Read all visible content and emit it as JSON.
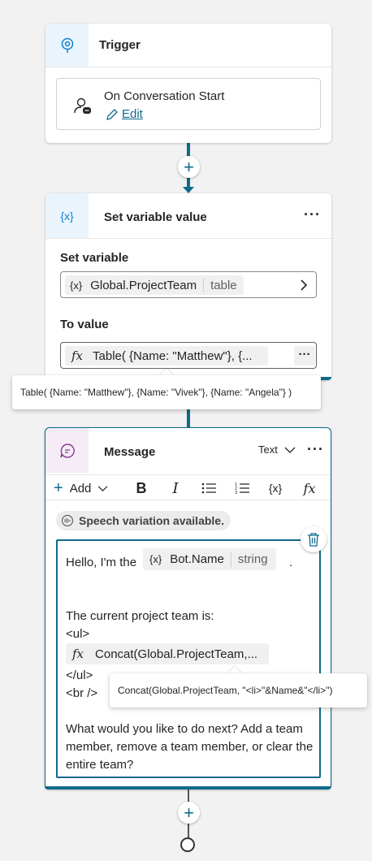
{
  "trigger": {
    "title": "Trigger",
    "event_label": "On Conversation Start",
    "edit_label": "Edit"
  },
  "set_variable": {
    "title": "Set variable value",
    "more_label": "···",
    "set_label": "Set variable",
    "variable_icon": "{x}",
    "variable_name": "Global.ProjectTeam",
    "variable_type": "table",
    "to_value_label": "To value",
    "formula_icon": "fx",
    "formula_preview": "Table( {Name: \"Matthew\"}, {...",
    "formula_more": "···",
    "tooltip": "Table( {Name: \"Matthew\"}, {Name: \"Vivek\"}, {Name: \"Angela\"} )"
  },
  "message": {
    "title": "Message",
    "type_label": "Text",
    "more_label": "···",
    "toolbar": {
      "add_label": "Add",
      "bold": "B",
      "italic": "I",
      "var_icon": "{x}",
      "formula_icon": "fx"
    },
    "speech_badge": "Speech variation available.",
    "line1": "Hello, I'm the",
    "bot_var_icon": "{x}",
    "bot_var_name": "Bot.Name",
    "bot_var_type": "string",
    "line1_end": ".",
    "line2": "The current project team is:",
    "line3": "<ul>",
    "concat_icon": "fx",
    "concat_preview": "Concat(Global.ProjectTeam,...",
    "line4": "</ul>",
    "line5": "<br />",
    "concat_tooltip": "Concat(Global.ProjectTeam, \"<li>\"&Name&\"</li>\")",
    "closing": "What would you like to do next? Add a team member, remove a team member, or clear the entire team?"
  },
  "colors": {
    "accent": "#0f6a8b",
    "trigger_icon": "#0f7fd1",
    "message_icon": "#8a3c8f"
  }
}
